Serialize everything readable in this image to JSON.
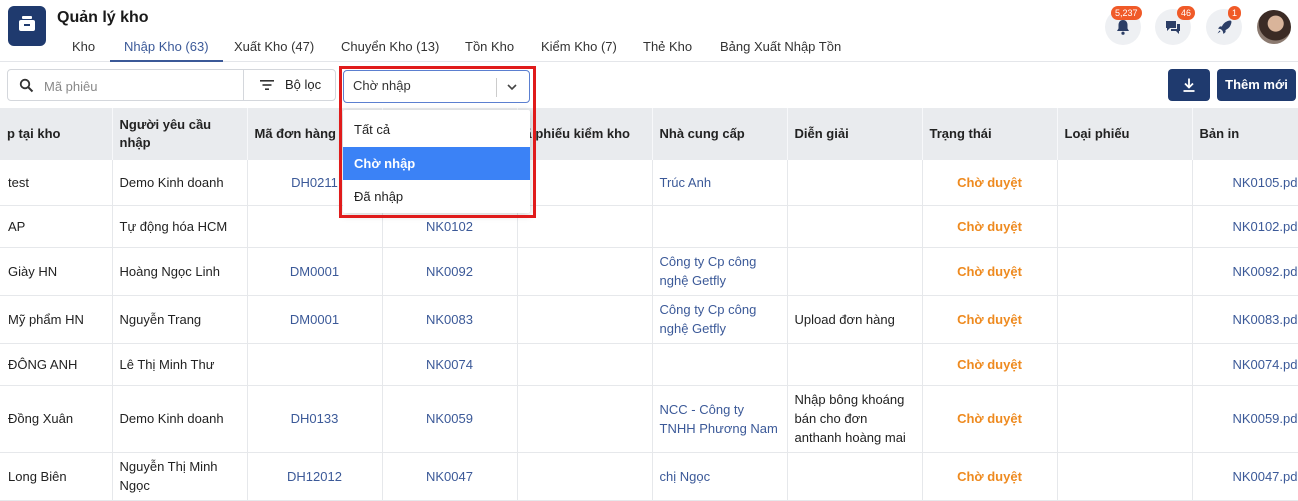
{
  "app": {
    "title": "Quản lý kho"
  },
  "tabs": [
    {
      "label": "Kho"
    },
    {
      "label": "Nhập Kho (63)"
    },
    {
      "label": "Xuất Kho (47)"
    },
    {
      "label": "Chuyển Kho (13)"
    },
    {
      "label": "Tồn Kho"
    },
    {
      "label": "Kiểm Kho (7)"
    },
    {
      "label": "Thẻ Kho"
    },
    {
      "label": "Bảng Xuất Nhập Tồn"
    }
  ],
  "header": {
    "notifications_badge": "5,237",
    "messages_badge": "46",
    "rocket_badge": "1"
  },
  "toolbar": {
    "search_placeholder": "Mã phiêu",
    "filter_label": "Bộ lọc",
    "status_select_value": "Chờ nhập",
    "add_label": "Thêm mới"
  },
  "dropdown": {
    "options": [
      "Tất cả",
      "Chờ nhập",
      "Đã nhập"
    ],
    "selected": "Chờ nhập"
  },
  "table": {
    "columns": [
      "p tại kho",
      "Người yêu cầu nhập",
      "Mã đơn hàng",
      "",
      "ã phiếu kiểm kho",
      "Nhà cung cấp",
      "Diễn giải",
      "Trạng thái",
      "Loại phiếu",
      "Bản in"
    ],
    "rows": [
      {
        "kho": "test",
        "nguoi": "Demo Kinh doanh",
        "don": "DH0211",
        "phieu": "",
        "kiem": "",
        "ncc": "Trúc Anh",
        "dien": "",
        "trang": "Chờ duyệt",
        "loai": "",
        "ban": "NK0105.pd"
      },
      {
        "kho": "AP",
        "nguoi": "Tự động hóa HCM",
        "don": "",
        "phieu": "NK0102",
        "kiem": "",
        "ncc": "",
        "dien": "",
        "trang": "Chờ duyệt",
        "loai": "",
        "ban": "NK0102.pd"
      },
      {
        "kho": "Giày HN",
        "nguoi": "Hoàng Ngọc Linh",
        "don": "DM0001",
        "phieu": "NK0092",
        "kiem": "",
        "ncc": "Công ty Cp công nghệ Getfly",
        "dien": "",
        "trang": "Chờ duyệt",
        "loai": "",
        "ban": "NK0092.pd"
      },
      {
        "kho": "Mỹ phẩm HN",
        "nguoi": "Nguyễn Trang",
        "don": "DM0001",
        "phieu": "NK0083",
        "kiem": "",
        "ncc": "Công ty Cp công nghệ Getfly",
        "dien": "Upload đơn hàng",
        "trang": "Chờ duyệt",
        "loai": "",
        "ban": "NK0083.pd"
      },
      {
        "kho": "ĐÔNG ANH",
        "nguoi": "Lê Thị Minh Thư",
        "don": "",
        "phieu": "NK0074",
        "kiem": "",
        "ncc": "",
        "dien": "",
        "trang": "Chờ duyệt",
        "loai": "",
        "ban": "NK0074.pd"
      },
      {
        "kho": "Đồng Xuân",
        "nguoi": "Demo Kinh doanh",
        "don": "DH0133",
        "phieu": "NK0059",
        "kiem": "",
        "ncc": "NCC - Công ty TNHH Phương Nam",
        "dien": "Nhập bông khoáng bán cho đơn anthanh hoàng mai",
        "trang": "Chờ duyệt",
        "loai": "",
        "ban": "NK0059.pd"
      },
      {
        "kho": "Long Biên",
        "nguoi": "Nguyễn Thị Minh Ngọc",
        "don": "DH12012",
        "phieu": "NK0047",
        "kiem": "",
        "ncc": "chị Ngọc",
        "dien": "",
        "trang": "Chờ duyệt",
        "loai": "",
        "ban": "NK0047.pd"
      }
    ]
  }
}
